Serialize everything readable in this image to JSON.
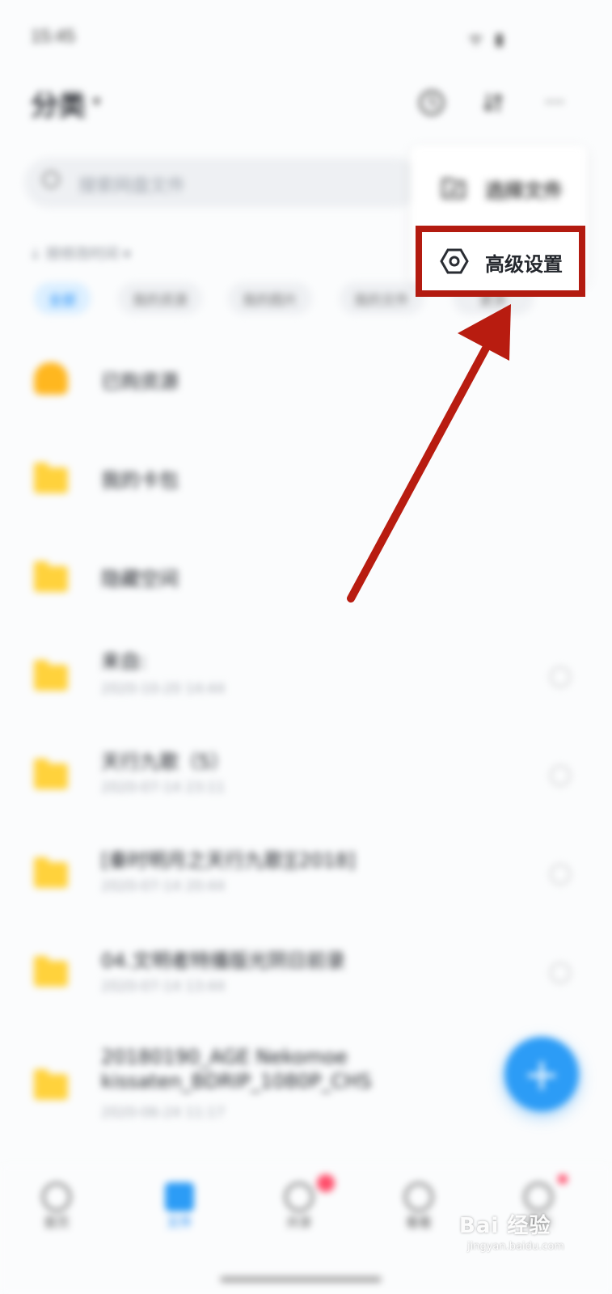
{
  "status": {
    "time": "15:45",
    "icons": "ᯤ ▮"
  },
  "header": {
    "title": "分类",
    "caret": "▾",
    "icons": [
      "history-icon",
      "transfer-icon",
      "more-icon"
    ],
    "more_glyph": "···"
  },
  "search": {
    "placeholder": "搜索网盘文件"
  },
  "sort": {
    "label": "↓ 按修改时间 ▾"
  },
  "chips": [
    "全部",
    "我的资源",
    "我的图片",
    "我的文件",
    "更多"
  ],
  "files": [
    {
      "name": "已购资源",
      "date": "",
      "icon": "special"
    },
    {
      "name": "我的卡包",
      "date": "",
      "icon": "folder"
    },
    {
      "name": "隐藏空间",
      "date": "",
      "icon": "folder"
    },
    {
      "name": "来自:",
      "date": "2020-10-20 14:44",
      "icon": "folder"
    },
    {
      "name": "天行九歌（5）",
      "date": "2020-07-14 23:11",
      "icon": "folder"
    },
    {
      "name": "[秦时明月之天行九歌][2018]",
      "date": "2020-07-14 20:44",
      "icon": "folder"
    },
    {
      "name": "04.文明者特播版光阴日前录",
      "date": "2020-07-14 13:44",
      "icon": "folder"
    },
    {
      "name": "20180190_AGE Nekomoe kissaten_BDRIP_1080P_CHS",
      "date": "2020-06-24 11:17",
      "icon": "folder"
    }
  ],
  "fab": {
    "glyph": "+"
  },
  "nav": [
    {
      "label": "首页"
    },
    {
      "label": "文件"
    },
    {
      "label": "共享"
    },
    {
      "label": "看看"
    },
    {
      "label": "我的"
    }
  ],
  "popup": {
    "items": [
      {
        "label": "选择文件",
        "icon": "folder-select-icon"
      },
      {
        "label": "高级设置",
        "icon": "settings-hexagon-icon"
      }
    ]
  },
  "annotation": {
    "color": "#b31b10"
  },
  "watermark": {
    "brand": "Bai 经验",
    "url": "jingyan.baidu.com"
  }
}
